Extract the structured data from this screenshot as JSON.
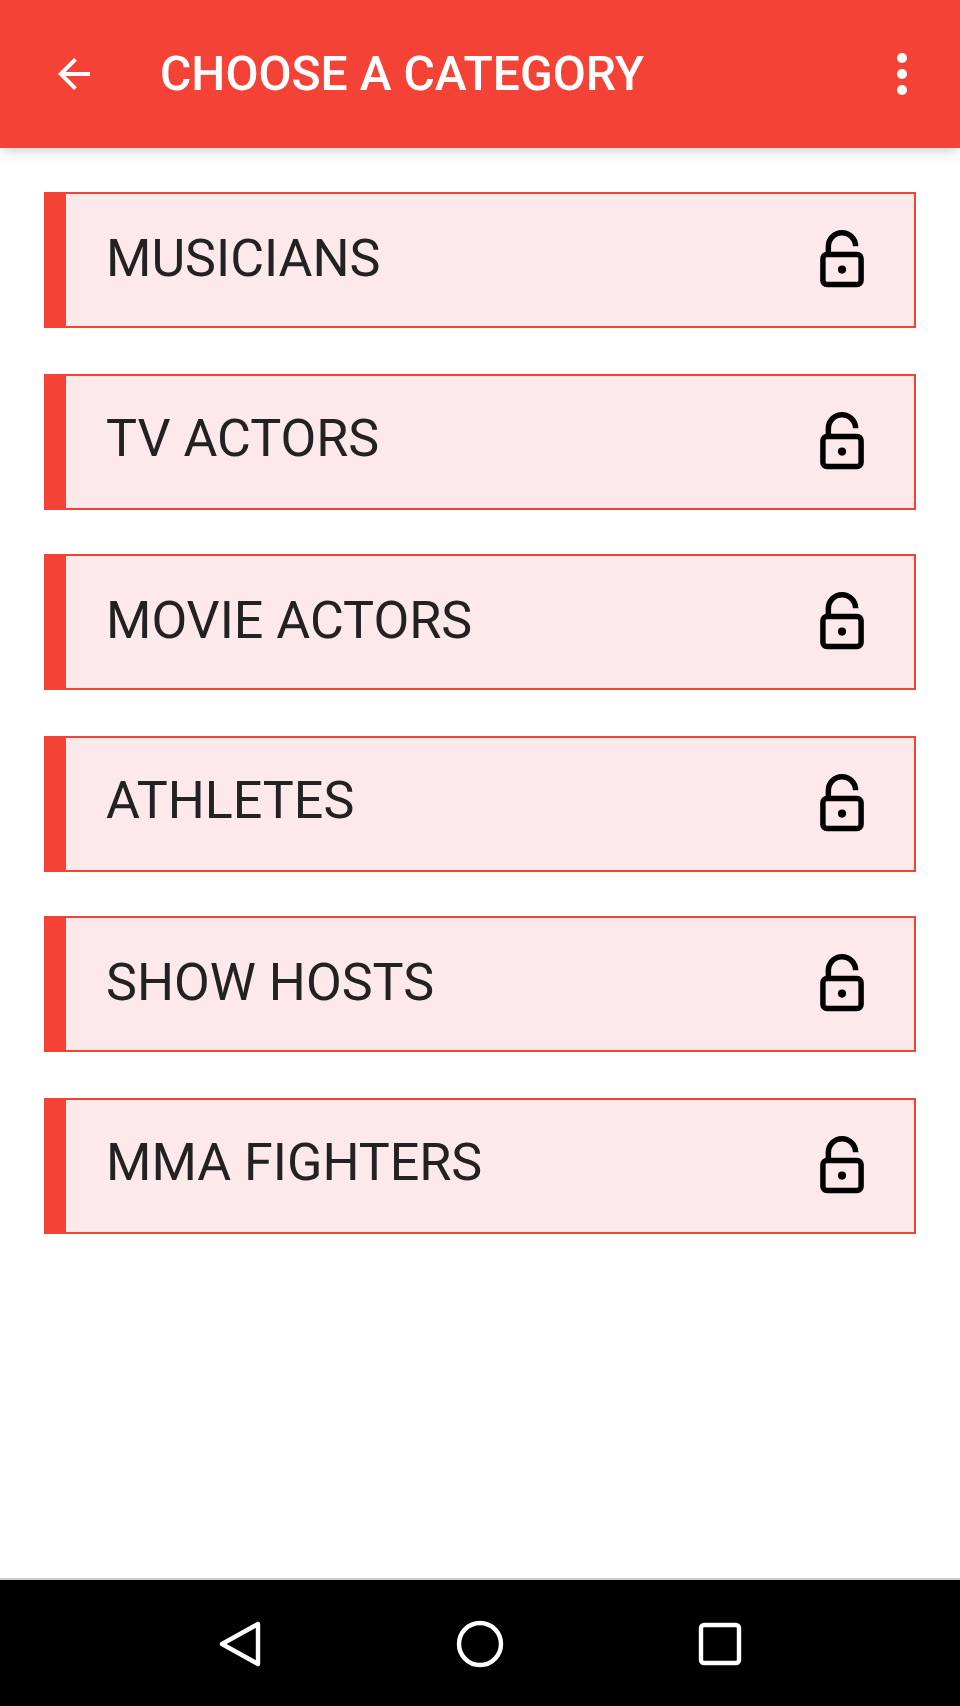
{
  "app_bar": {
    "title": "CHOOSE A CATEGORY"
  },
  "categories": [
    {
      "label": "MUSICIANS",
      "locked": false
    },
    {
      "label": "TV ACTORS",
      "locked": false
    },
    {
      "label": "MOVIE ACTORS",
      "locked": false
    },
    {
      "label": "ATHLETES",
      "locked": false
    },
    {
      "label": "SHOW HOSTS",
      "locked": false
    },
    {
      "label": "MMA FIGHTERS",
      "locked": false
    }
  ]
}
